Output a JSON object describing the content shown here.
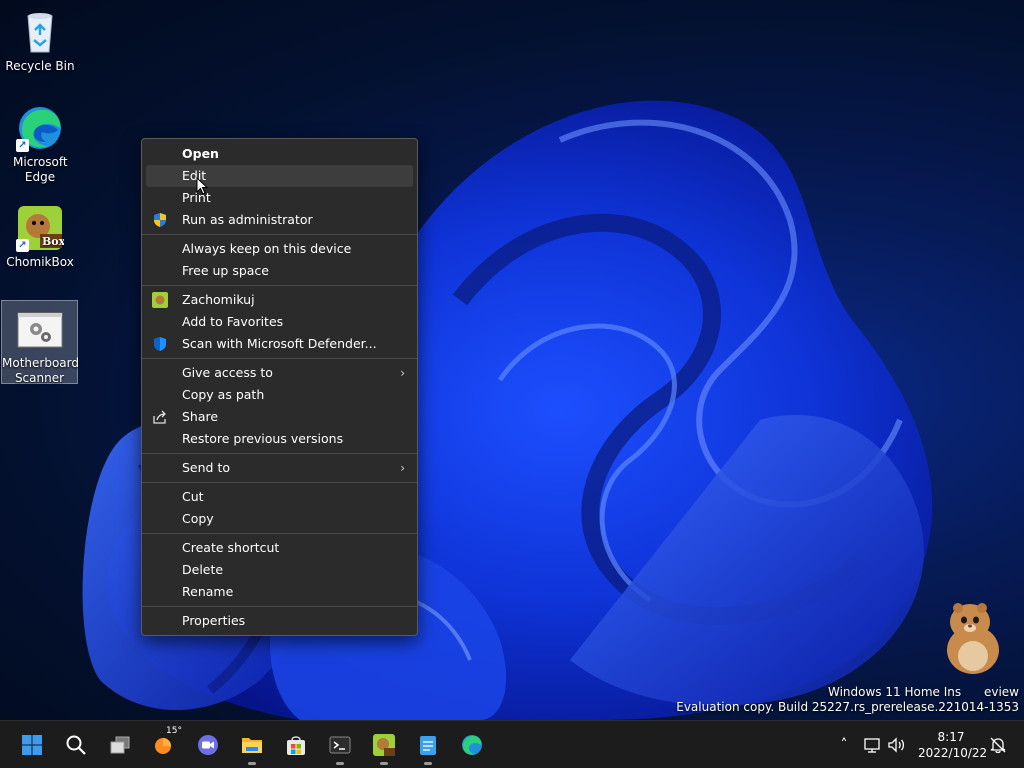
{
  "desktop": {
    "icons": [
      {
        "label": "Recycle Bin"
      },
      {
        "label": "Microsoft Edge"
      },
      {
        "label": "ChomikBox"
      },
      {
        "label": "Motherboard Scanner"
      }
    ]
  },
  "context_menu": {
    "items": [
      "Open",
      "Edit",
      "Print",
      "Run as administrator",
      "Always keep on this device",
      "Free up space",
      "Zachomikuj",
      "Add to Favorites",
      "Scan with Microsoft Defender...",
      "Give access to",
      "Copy as path",
      "Share",
      "Restore previous versions",
      "Send to",
      "Cut",
      "Copy",
      "Create shortcut",
      "Delete",
      "Rename",
      "Properties"
    ]
  },
  "watermark": {
    "line1": "Windows 11 Home Ins      eview",
    "line2": "Evaluation copy. Build 25227.rs_prerelease.221014-1353"
  },
  "taskbar": {
    "weather_temp": "15°",
    "clock_time": "8:17",
    "clock_date": "2022/10/22"
  },
  "colors": {
    "menu_bg": "#2b2b2b",
    "taskbar_bg": "#1c1c1c",
    "accent": "#0a64d8"
  }
}
